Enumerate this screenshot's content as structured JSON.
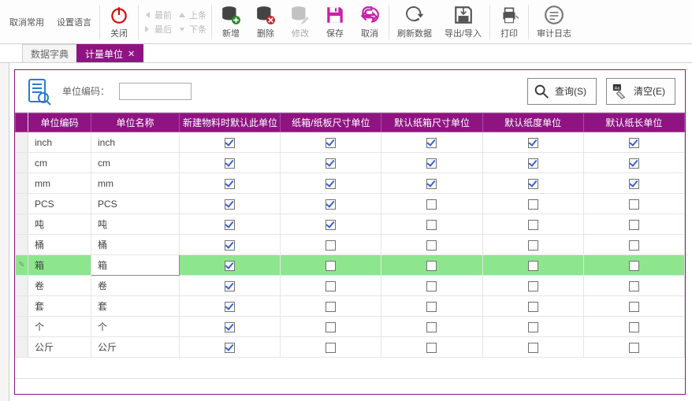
{
  "toolbar": {
    "cancel_common": "取消常用",
    "close": "关闭",
    "lang": "设置语言",
    "nav": {
      "first": "最前",
      "prev": "上条",
      "last": "最后",
      "next": "下条"
    },
    "add": "新增",
    "del": "删除",
    "edit": "修改",
    "save": "保存",
    "undo": "取消",
    "refresh": "刷新数据",
    "export": "导出/导入",
    "print": "打印",
    "audit": "审计日志"
  },
  "tabs": {
    "dict": "数据字典",
    "unit": "计量单位"
  },
  "search": {
    "label": "单位编码：",
    "query_btn": "查询(S)",
    "clear_btn": "清空(E)",
    "value": ""
  },
  "columns": [
    "单位编码",
    "单位名称",
    "新建物料时默认此单位",
    "纸箱/纸板尺寸单位",
    "默认纸箱尺寸单位",
    "默认纸度单位",
    "默认纸长单位"
  ],
  "rows": [
    {
      "code": "inch",
      "name": "inch",
      "c": [
        true,
        true,
        true,
        true,
        true
      ],
      "sel": false
    },
    {
      "code": "cm",
      "name": "cm",
      "c": [
        true,
        true,
        true,
        true,
        true
      ],
      "sel": false
    },
    {
      "code": "mm",
      "name": "mm",
      "c": [
        true,
        true,
        true,
        true,
        true
      ],
      "sel": false
    },
    {
      "code": "PCS",
      "name": "PCS",
      "c": [
        true,
        true,
        false,
        false,
        false
      ],
      "sel": false
    },
    {
      "code": "吨",
      "name": "吨",
      "c": [
        true,
        true,
        false,
        false,
        false
      ],
      "sel": false
    },
    {
      "code": "桶",
      "name": "桶",
      "c": [
        true,
        false,
        false,
        false,
        false
      ],
      "sel": false
    },
    {
      "code": "箱",
      "name": "箱",
      "c": [
        true,
        false,
        false,
        false,
        false
      ],
      "sel": true
    },
    {
      "code": "卷",
      "name": "卷",
      "c": [
        true,
        false,
        false,
        false,
        false
      ],
      "sel": false
    },
    {
      "code": "套",
      "name": "套",
      "c": [
        true,
        false,
        false,
        false,
        false
      ],
      "sel": false
    },
    {
      "code": "个",
      "name": "个",
      "c": [
        true,
        false,
        false,
        false,
        false
      ],
      "sel": false
    },
    {
      "code": "公斤",
      "name": "公斤",
      "c": [
        true,
        false,
        false,
        false,
        false
      ],
      "sel": false
    }
  ]
}
